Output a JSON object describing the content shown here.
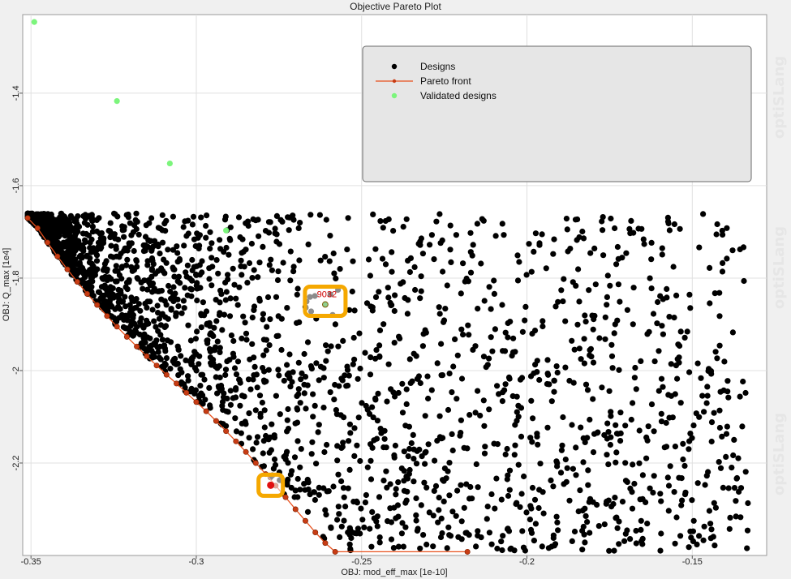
{
  "window": {
    "title": "Objective Pareto Plot",
    "watermark": "optiSLang"
  },
  "colors": {
    "designs": "#000000",
    "pareto": "#e8501c",
    "pareto_marker": "#c83c14",
    "validated": "#7cf57c",
    "highlight": "#f5a800",
    "highlight_label": "#d00000",
    "plot_bg": "#ffffff",
    "grid": "#e0e0e0"
  },
  "chart_data": {
    "type": "scatter",
    "title": "Objective Pareto Plot",
    "xlabel": "OBJ: mod_eff_max [1e-10]",
    "ylabel": "OBJ: Q_max [1e4]",
    "xlim": [
      -0.3525,
      -0.1275
    ],
    "ylim": [
      -2.4,
      -1.23
    ],
    "xticks": [
      -0.35,
      -0.3,
      -0.25,
      -0.2,
      -0.15
    ],
    "xtick_labels": [
      "-0.35",
      "-0.3",
      "-0.25",
      "-0.2",
      "-0.15"
    ],
    "yticks": [
      -1.4,
      -1.6,
      -1.8,
      -2,
      -2.2
    ],
    "ytick_labels": [
      "-1.4",
      "-1.6",
      "-1.8",
      "-2",
      "-2.2"
    ],
    "grid": true,
    "legend": {
      "placement": "top-right",
      "entries": [
        "Designs",
        "Pareto front",
        "Validated designs"
      ]
    },
    "series": [
      {
        "name": "Designs",
        "kind": "scatter",
        "count_approx": 2500,
        "region_description_values": {
          "x_range": [
            -0.351,
            -0.133
          ],
          "y_range": [
            -2.39,
            -1.66
          ]
        }
      },
      {
        "name": "Pareto front",
        "kind": "line",
        "x": [
          -0.351,
          -0.348,
          -0.345,
          -0.342,
          -0.339,
          -0.336,
          -0.333,
          -0.33,
          -0.327,
          -0.324,
          -0.321,
          -0.318,
          -0.315,
          -0.312,
          -0.309,
          -0.306,
          -0.303,
          -0.3,
          -0.297,
          -0.294,
          -0.291,
          -0.288,
          -0.285,
          -0.282,
          -0.279,
          -0.276,
          -0.273,
          -0.27,
          -0.267,
          -0.264,
          -0.261,
          -0.258,
          -0.218
        ],
        "y": [
          -1.67,
          -1.692,
          -1.723,
          -1.753,
          -1.781,
          -1.808,
          -1.834,
          -1.858,
          -1.882,
          -1.905,
          -1.927,
          -1.948,
          -1.969,
          -1.989,
          -2.009,
          -2.028,
          -2.048,
          -2.068,
          -2.088,
          -2.109,
          -2.131,
          -2.153,
          -2.176,
          -2.2,
          -2.224,
          -2.249,
          -2.274,
          -2.3,
          -2.325,
          -2.35,
          -2.373,
          -2.392,
          -2.392
        ]
      },
      {
        "name": "Validated designs",
        "kind": "scatter",
        "x": [
          -0.349,
          -0.324,
          -0.308,
          -0.291
        ],
        "y": [
          -1.246,
          -1.417,
          -1.552,
          -1.697
        ]
      }
    ],
    "highlights": [
      {
        "label": "9032",
        "x": -0.261,
        "y": -1.85
      },
      {
        "label": "",
        "x": -0.2775,
        "y": -2.248
      }
    ]
  }
}
